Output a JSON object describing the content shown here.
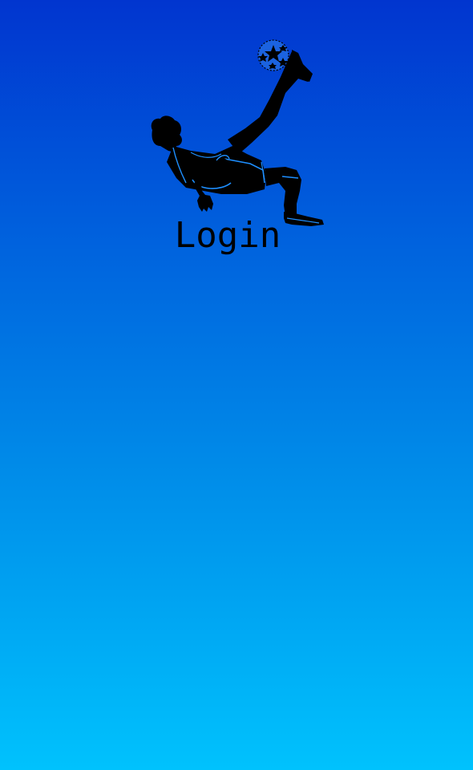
{
  "screen": {
    "title": "Login"
  },
  "logo": {
    "icon": "bicycle-kick-player-icon",
    "ball_icon": "star-ball-icon"
  },
  "colors": {
    "gradient_top": "#0135cf",
    "gradient_bottom": "#00c2fd",
    "text": "#000000",
    "silhouette": "#000000",
    "outline": "#1e8fff"
  }
}
